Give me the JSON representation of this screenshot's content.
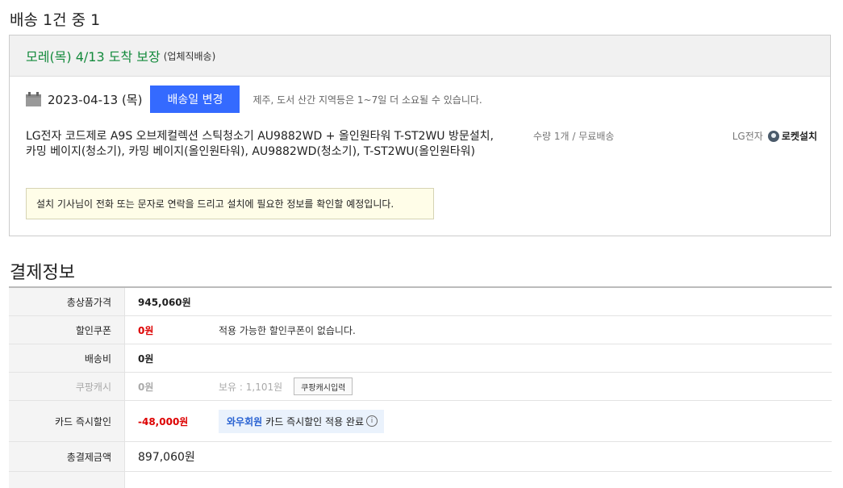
{
  "shipment": {
    "title": "배송 1건 중 1",
    "arrival": "모레(목) 4/13 도착 보장",
    "ship_type": "(업체직배송)",
    "date": "2023-04-13 (목)",
    "change_button": "배송일 변경",
    "note": "제주, 도서 산간 지역등은 1~7일 더 소요될 수 있습니다.",
    "product_name": "LG전자 코드제로 A9S 오브제컬렉션 스틱청소기 AU9882WD + 올인원타워 T-ST2WU 방문설치, 카밍 베이지(청소기), 카밍 베이지(올인원타워), AU9882WD(청소기), T-ST2WU(올인원타워)",
    "quantity": "수량 1개 / 무료배송",
    "seller": "LG전자",
    "rocket_label": "로켓설치",
    "install_note": "설치 기사님이 전화 또는 문자로 연락을 드리고 설치에 필요한 정보를 확인할 예정입니다."
  },
  "payment": {
    "title": "결제정보",
    "rows": {
      "product_total": {
        "label": "총상품가격",
        "value": "945,060원"
      },
      "coupon": {
        "label": "할인쿠폰",
        "value": "0원",
        "note": "적용 가능한 할인쿠폰이 없습니다."
      },
      "shipping": {
        "label": "배송비",
        "value": "0원"
      },
      "cash": {
        "label": "쿠팡캐시",
        "value": "0원",
        "balance": "보유 : 1,101원",
        "button": "쿠팡캐시입력"
      },
      "card": {
        "label": "카드 즉시할인",
        "value": "-48,000원",
        "wow_name": "와우회원",
        "wow_text": "카드 즉시할인 적용 완료",
        "info": "i"
      },
      "total": {
        "label": "총결제금액",
        "value": "897,060원"
      }
    }
  },
  "colors": {
    "accent": "#346aff",
    "green": "#138a3c",
    "red": "#dd0000"
  }
}
